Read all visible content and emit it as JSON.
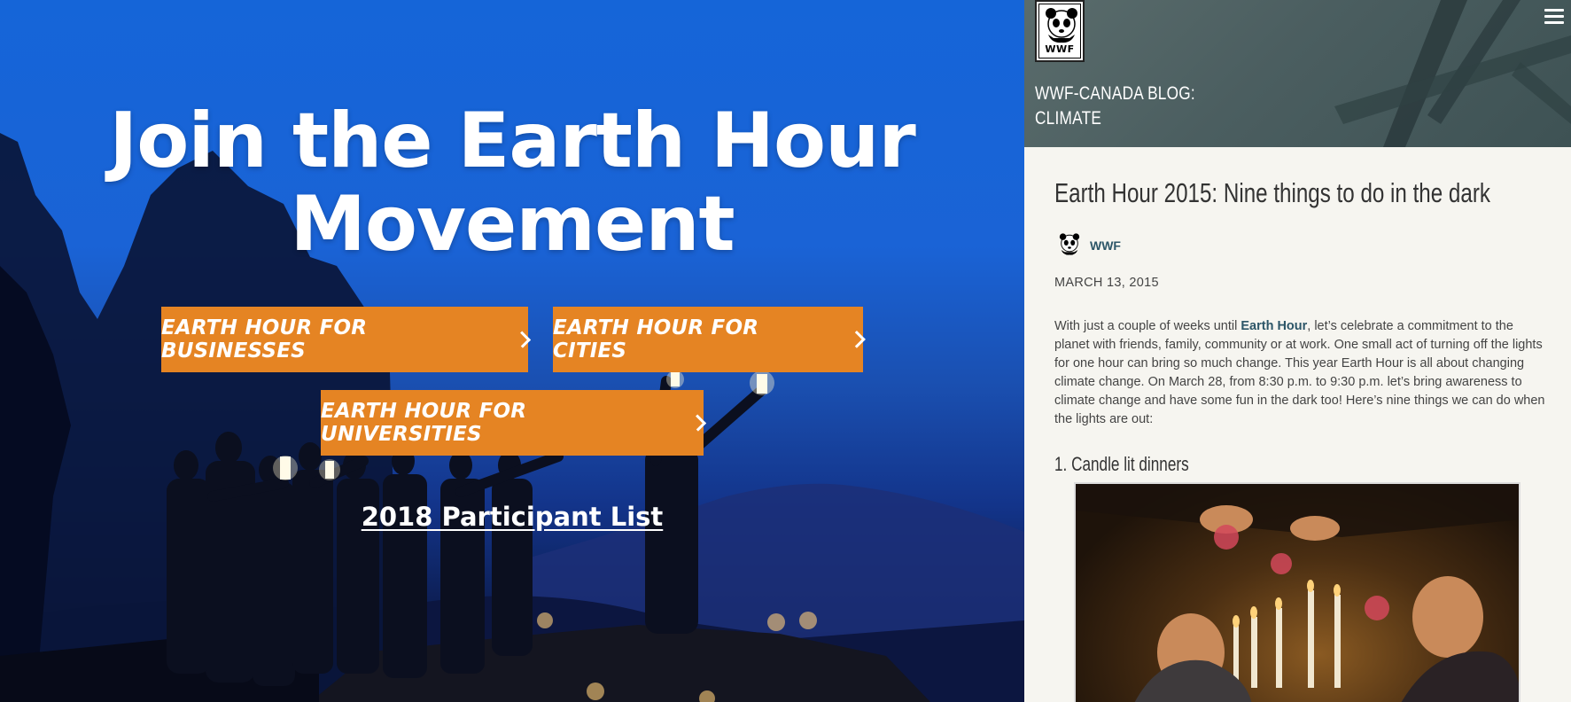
{
  "hero": {
    "title": "Join the Earth Hour Movement",
    "buttons": [
      {
        "label": "EARTH HOUR FOR BUSINESSES"
      },
      {
        "label": "EARTH HOUR FOR CITIES"
      },
      {
        "label": "EARTH HOUR FOR UNIVERSITIES"
      }
    ],
    "participant_link": "2018 Participant List"
  },
  "sidebar": {
    "logo_text": "WWF",
    "blog_label_line1": "WWF-CANADA BLOG:",
    "blog_label_line2": "CLIMATE",
    "post": {
      "title": "Earth Hour 2015: Nine things to do in the dark",
      "author": "WWF",
      "date": "MARCH 13, 2015",
      "body_before_link": "With just a couple of weeks until ",
      "body_link": "Earth Hour",
      "body_after_link": ", let’s celebrate a commitment to the planet with friends, family, community or at work. One small act of turning off the lights for one hour can bring so much change. This year Earth Hour is all about changing climate change. On March 28, from 8:30 p.m. to 9:30 p.m. let’s bring awareness to climate change and have some fun in the dark too! Here’s nine things we can do when the lights are out:",
      "section_heading": "1. Candle lit dinners"
    }
  },
  "colors": {
    "accent_orange": "#e58423",
    "hero_blue": "#1a63d6",
    "link_teal": "#2d5668",
    "sidebar_bg": "#f6f5f0"
  },
  "icons": {
    "menu": "hamburger-menu-icon",
    "chevron": "chevron-right-icon",
    "logo": "panda-logo-icon"
  }
}
